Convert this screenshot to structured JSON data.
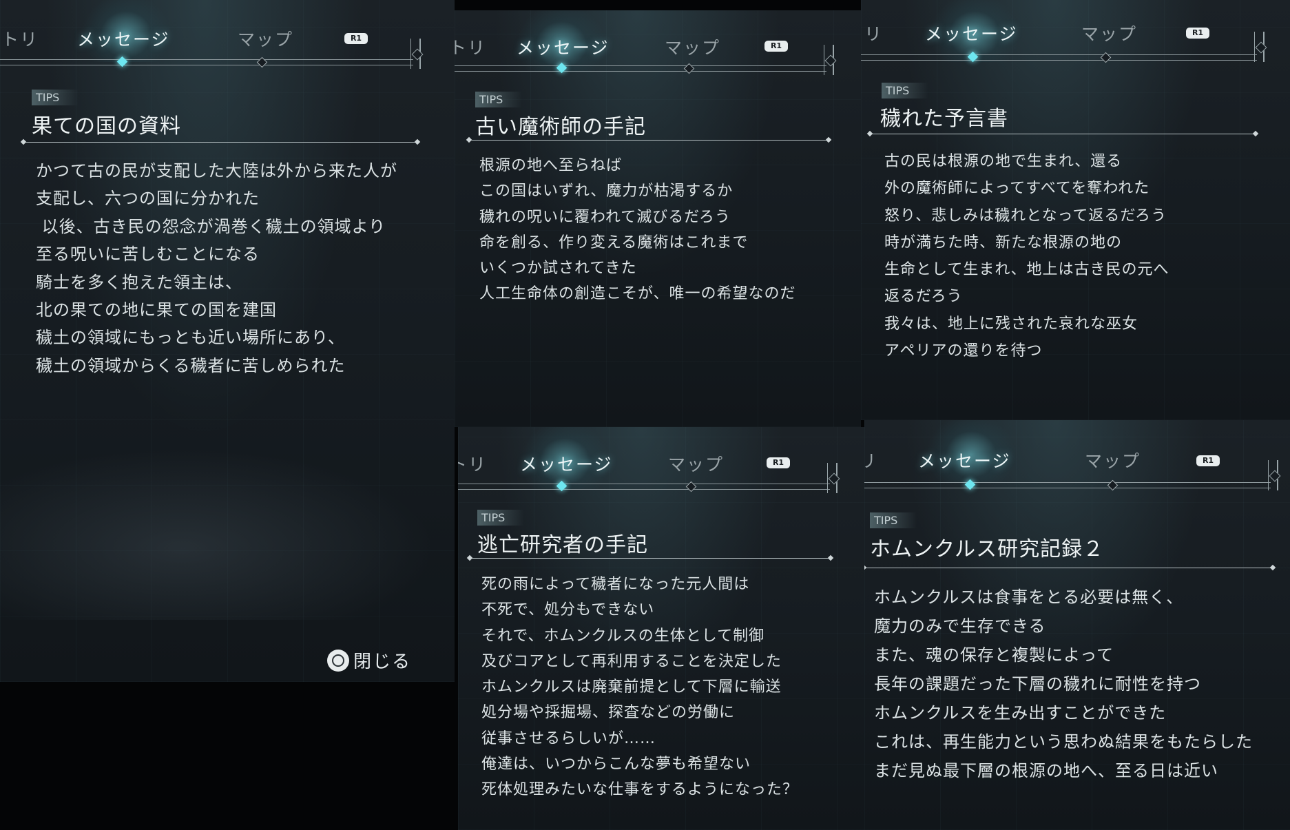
{
  "tabs": {
    "prev": "トリ",
    "active": "メッセージ",
    "next": "マップ",
    "button": "R1"
  },
  "panels": [
    {
      "tag": "TIPS",
      "title": "果ての国の資料",
      "lines": [
        "かつて古の民が支配した大陸は外から来た人が",
        "支配し、六つの国に分かれた",
        " 以後、古き民の怨念が渦巻く穢土の領域より",
        "至る呪いに苦しむことになる",
        "騎士を多く抱えた領主は、",
        "北の果ての地に果ての国を建国",
        "穢土の領域にもっとも近い場所にあり、",
        "穢土の領域からくる穢者に苦しめられた"
      ],
      "close_label": "閉じる"
    },
    {
      "tag": "TIPS",
      "title": "古い魔術師の手記",
      "lines": [
        "根源の地へ至らねば",
        "この国はいずれ、魔力が枯渇するか",
        "穢れの呪いに覆われて滅びるだろう",
        "命を創る、作り変える魔術はこれまで",
        "いくつか試されてきた",
        "人工生命体の創造こそが、唯一の希望なのだ"
      ]
    },
    {
      "tag": "TIPS",
      "title": "穢れた予言書",
      "lines": [
        "古の民は根源の地で生まれ、還る",
        "外の魔術師によってすべてを奪われた",
        "怒り、悲しみは穢れとなって返るだろう",
        "時が満ちた時、新たな根源の地の",
        "生命として生まれ、地上は古き民の元へ",
        "返るだろう",
        "我々は、地上に残された哀れな巫女",
        "アペリアの還りを待つ"
      ]
    },
    {
      "tag": "TIPS",
      "title": "逃亡研究者の手記",
      "lines": [
        "死の雨によって穢者になった元人間は",
        "不死で、処分もできない",
        "それで、ホムンクルスの生体として制御",
        "及びコアとして再利用することを決定した",
        "ホムンクルスは廃棄前提として下層に輸送",
        "処分場や採掘場、探査などの労働に",
        "従事させるらしいが……",
        "俺達は、いつからこんな夢も希望ない",
        "死体処理みたいな仕事をするようになった？"
      ]
    },
    {
      "tag": "TIPS",
      "title": "ホムンクルス研究記録２",
      "lines": [
        "ホムンクルスは食事をとる必要は無く、",
        "魔力のみで生存できる",
        "また、魂の保存と複製によって",
        "長年の課題だった下層の穢れに耐性を持つ",
        "ホムンクルスを生み出すことができた",
        "これは、再生能力という思わぬ結果をもたらした",
        "まだ見ぬ最下層の根源の地へ、至る日は近い"
      ]
    }
  ]
}
